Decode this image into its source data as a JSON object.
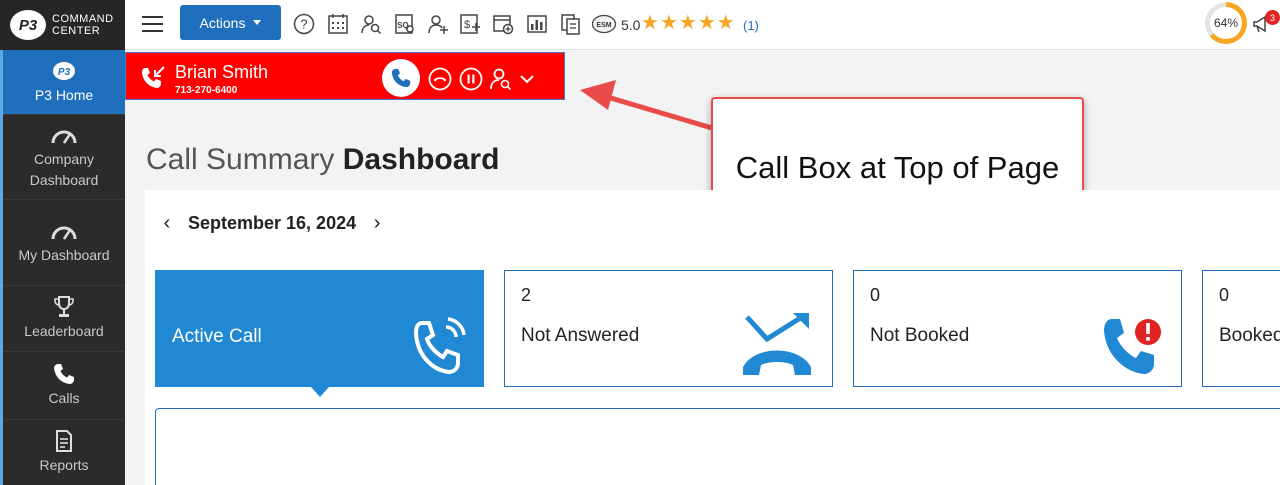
{
  "brand": {
    "logo_mark": "P3",
    "line1": "COMMAND",
    "line2": "CENTER"
  },
  "sidebar": {
    "items": [
      {
        "label": "P3 Home",
        "icon": "p3-home-icon"
      },
      {
        "label": "Company Dashboard",
        "icon": "gauge-icon"
      },
      {
        "label": "My Dashboard",
        "icon": "gauge-icon"
      },
      {
        "label": "Leaderboard",
        "icon": "trophy-icon"
      },
      {
        "label": "Calls",
        "icon": "phone-icon"
      },
      {
        "label": "Reports",
        "icon": "report-icon"
      }
    ]
  },
  "toolbar": {
    "actions_label": "Actions",
    "icons": [
      "help-icon",
      "calendar-icon",
      "user-search-icon",
      "search-doc-icon",
      "add-user-icon",
      "add-money-icon",
      "add-event-icon",
      "bar-chart-icon",
      "documents-icon",
      "esm-icon"
    ],
    "esm_label": "ESM",
    "rating": "5.0",
    "rating_count": "(1)",
    "progress": "64%",
    "progress_value": 64,
    "notification_count": "3"
  },
  "callbox": {
    "caller_name": "Brian Smith",
    "caller_phone": "713-270-6400",
    "color": "#ff0000"
  },
  "annotation": {
    "text": "Call Box at Top of Page"
  },
  "page": {
    "title_light": "Call Summary",
    "title_bold": "Dashboard",
    "date": "September 16, 2024"
  },
  "cards": [
    {
      "label": "Active Call",
      "count": ""
    },
    {
      "label": "Not Answered",
      "count": "2"
    },
    {
      "label": "Not Booked",
      "count": "0"
    },
    {
      "label": "Booked",
      "count": "0"
    }
  ],
  "colors": {
    "accent": "#1f6fbd",
    "card_active": "#2189d4",
    "star": "#f5a623",
    "alert": "#e02424"
  }
}
